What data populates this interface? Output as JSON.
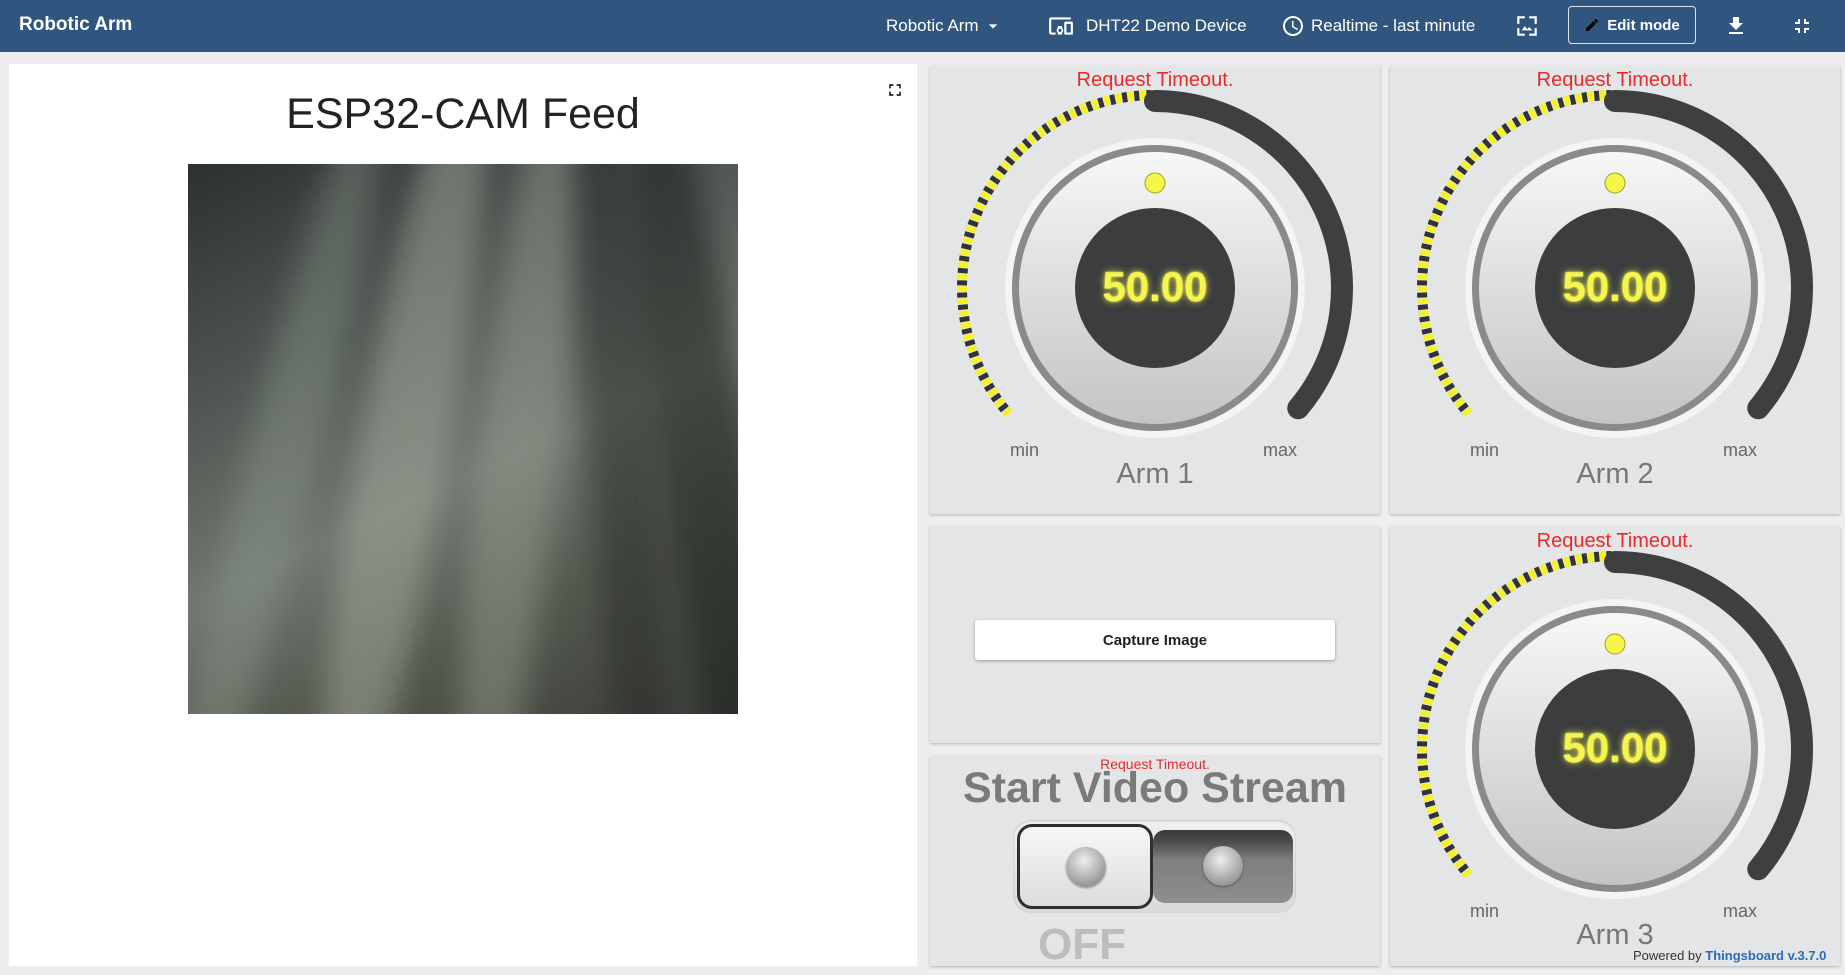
{
  "toolbar": {
    "title": "Robotic Arm",
    "dashboard_state": "Robotic Arm",
    "entity_alias": "DHT22 Demo Device",
    "timewindow": "Realtime - last minute",
    "edit_mode": "Edit mode"
  },
  "camera": {
    "title": "ESP32-CAM Feed"
  },
  "gauges": [
    {
      "label": "Arm 1",
      "value": "50.00",
      "min_label": "min",
      "max_label": "max",
      "error": "Request Timeout.",
      "level": 0.5
    },
    {
      "label": "Arm 2",
      "value": "50.00",
      "min_label": "min",
      "max_label": "max",
      "error": "Request Timeout.",
      "level": 0.5
    },
    {
      "label": "Arm 3",
      "value": "50.00",
      "min_label": "min",
      "max_label": "max",
      "error": "Request Timeout.",
      "level": 0.5
    }
  ],
  "capture": {
    "button_label": "Capture Image"
  },
  "video_stream": {
    "error": "Request Timeout.",
    "title": "Start Video Stream",
    "state": "OFF"
  },
  "footer": {
    "powered_by": "Powered by",
    "brand": "Thingsboard v.3.7.0"
  },
  "colors": {
    "toolbar": "#305680",
    "error": "#ea2a2a",
    "gauge_value": "#f5f54a",
    "gauge_ticks": "#f5f21e"
  }
}
